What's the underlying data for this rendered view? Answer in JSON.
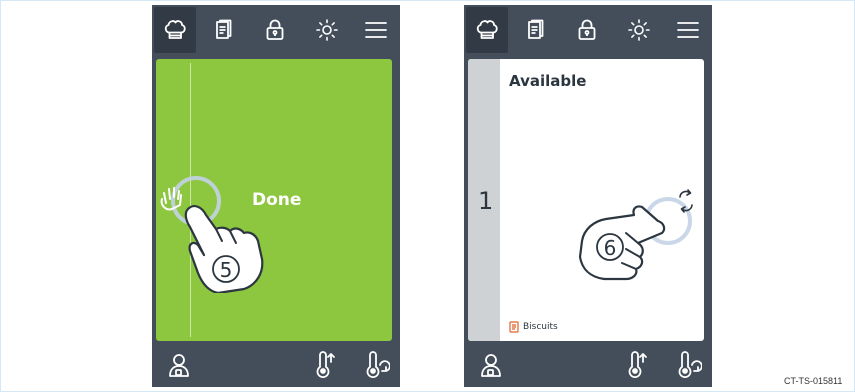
{
  "left_screen": {
    "topbar": {
      "icons": [
        "chef-hat-icon",
        "recipe-book-icon",
        "lock-icon",
        "sun-icon",
        "menu-icon"
      ],
      "active": "chef-hat-icon"
    },
    "card": {
      "status_label": "Done",
      "background": "#8dc63f"
    },
    "step_number": "5",
    "bottombar": {
      "icons": [
        "user-icon",
        "temperature-up-icon",
        "temperature-refresh-icon"
      ]
    }
  },
  "right_screen": {
    "topbar": {
      "icons": [
        "chef-hat-icon",
        "recipe-book-icon",
        "lock-icon",
        "sun-icon",
        "menu-icon"
      ],
      "active": "chef-hat-icon"
    },
    "card": {
      "slot_number": "1",
      "status_label": "Available",
      "recipe_label": "Biscuits",
      "recipe_icon_color": "#e0622c"
    },
    "step_number": "6",
    "bottombar": {
      "icons": [
        "user-icon",
        "temperature-up-icon",
        "temperature-refresh-icon"
      ]
    }
  },
  "document_code": "CT-TS-015811",
  "colors": {
    "device_bg": "#434e5a",
    "active_tab_bg": "#323b45",
    "done_green": "#8dc63f",
    "slot_strip": "#cfd2d4"
  }
}
